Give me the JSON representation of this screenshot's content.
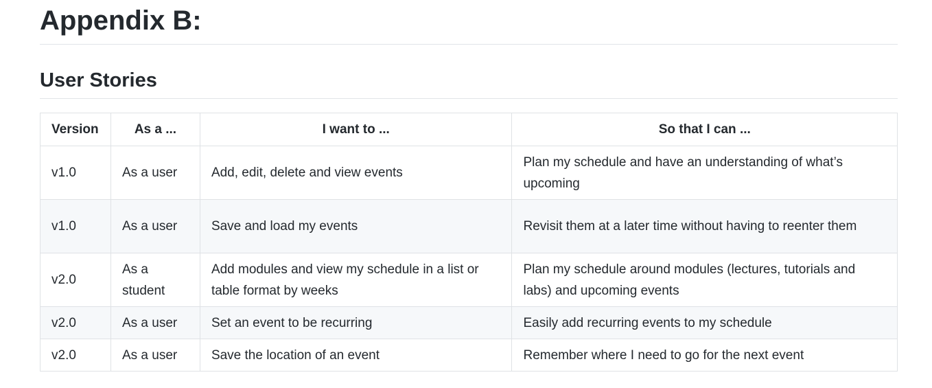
{
  "heading": "Appendix B:",
  "section_title": "User Stories",
  "table": {
    "headers": {
      "version": "Version",
      "as_a": "As a ...",
      "i_want_to": "I want to ...",
      "so_that": "So that I can ..."
    },
    "rows": [
      {
        "version": "v1.0",
        "as_a": "As a user",
        "i_want_to": "Add, edit, delete and view events",
        "so_that": "Plan my schedule and have an understanding of what’s upcoming"
      },
      {
        "version": "v1.0",
        "as_a": "As a user",
        "i_want_to": "Save and load my events",
        "so_that": "Revisit them at a later time without having to reenter them"
      },
      {
        "version": "v2.0",
        "as_a": "As a student",
        "i_want_to": "Add modules and view my schedule in a list or table format by weeks",
        "so_that": "Plan my schedule around modules (lectures, tutorials and labs) and upcoming events"
      },
      {
        "version": "v2.0",
        "as_a": "As a user",
        "i_want_to": "Set an event to be recurring",
        "so_that": "Easily add recurring events to my schedule"
      },
      {
        "version": "v2.0",
        "as_a": "As a user",
        "i_want_to": "Save the location of an event",
        "so_that": "Remember where I need to go for the next event"
      }
    ]
  }
}
